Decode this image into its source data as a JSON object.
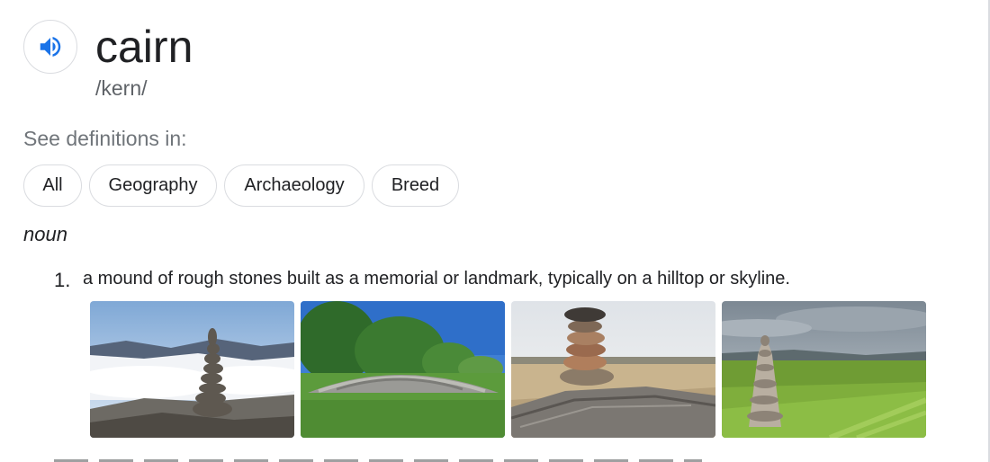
{
  "entry": {
    "word": "cairn",
    "phonetic": "/kern/",
    "audio_icon": "speaker-icon"
  },
  "definitions_in": {
    "label": "See definitions in:",
    "chips": [
      "All",
      "Geography",
      "Archaeology",
      "Breed"
    ]
  },
  "part_of_speech": "noun",
  "senses": [
    {
      "number": "1.",
      "text": "a mound of rough stones built as a memorial or landmark, typically on a hilltop or skyline."
    }
  ],
  "images": [
    "cairn-on-mountain-above-clouds",
    "grassy-stone-mound",
    "balanced-stone-stack-on-driftwood",
    "stone-pillar-in-green-field"
  ],
  "colors": {
    "accent": "#1a73e8",
    "border": "#dadce0",
    "text": "#202124",
    "muted": "#70757a"
  }
}
